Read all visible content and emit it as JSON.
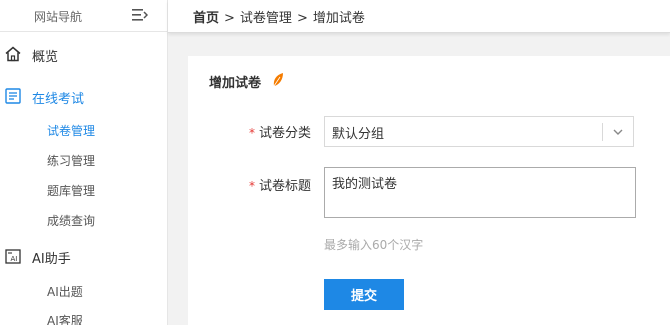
{
  "sidebar": {
    "title": "网站导航",
    "nav": [
      {
        "label": "概览",
        "icon": "home-icon"
      },
      {
        "label": "在线考试",
        "icon": "exam-list-icon"
      },
      {
        "label": "AI助手",
        "icon": "ai-icon"
      }
    ],
    "exam_sub": [
      {
        "label": "试卷管理"
      },
      {
        "label": "练习管理"
      },
      {
        "label": "题库管理"
      },
      {
        "label": "成绩查询"
      }
    ],
    "ai_sub": [
      {
        "label": "AI出题"
      },
      {
        "label": "AI客服"
      }
    ]
  },
  "breadcrumb": {
    "home": "首页",
    "sep": ">",
    "level1": "试卷管理",
    "level2": "增加试卷"
  },
  "form": {
    "title": "增加试卷",
    "required_mark": "*",
    "category_label": "试卷分类",
    "category_value": "默认分组",
    "title_label": "试卷标题",
    "title_value": "我的测试卷",
    "hint": "最多输入60个汉字",
    "submit_label": "提交"
  },
  "colors": {
    "accent": "#1e88e5",
    "required": "#e53935",
    "title_icon": "#f57c00"
  }
}
